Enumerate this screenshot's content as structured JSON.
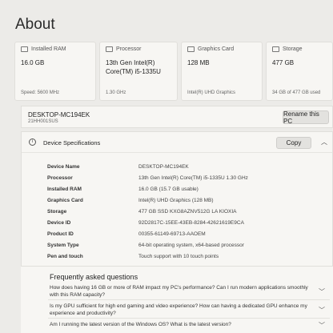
{
  "page": {
    "title": "About"
  },
  "cards": [
    {
      "icon": "ram-icon",
      "label": "Installed RAM",
      "value": "16.0 GB",
      "sub": "Speed: 5600 MHz"
    },
    {
      "icon": "processor-icon",
      "label": "Processor",
      "value": "13th Gen Intel(R) Core(TM) i5-1335U",
      "sub": "1.30 GHz"
    },
    {
      "icon": "graphics-card-icon",
      "label": "Graphics Card",
      "value": "128 MB",
      "sub": "Intel(R) UHD Graphics"
    },
    {
      "icon": "storage-icon",
      "label": "Storage",
      "value": "477 GB",
      "sub": "34 GB of 477 GB used"
    }
  ],
  "device": {
    "name": "DESKTOP-MC194EK",
    "model": "21HH001SUS",
    "rename_label": "Rename this PC"
  },
  "specs": {
    "title": "Device Specifications",
    "copy_label": "Copy",
    "rows": [
      {
        "key": "Device Name",
        "value": "DESKTOP-MC194EK"
      },
      {
        "key": "Processor",
        "value": "13th Gen Intel(R) Core(TM) i5-1335U   1.30 GHz"
      },
      {
        "key": "Installed RAM",
        "value": "16.0 GB (15.7 GB usable)"
      },
      {
        "key": "Graphics Card",
        "value": "Intel(R) UHD Graphics (128 MB)"
      },
      {
        "key": "Storage",
        "value": "477 GB SSD KXG8AZNV512G LA KIOXIA"
      },
      {
        "key": "Device ID",
        "value": "92D2817C-15EE-43EB-8284-42621619E9CA"
      },
      {
        "key": "Product ID",
        "value": "00355-61149-69713-AAOEM"
      },
      {
        "key": "System Type",
        "value": "64-bit operating system, x64-based processor"
      },
      {
        "key": "Pen and touch",
        "value": "Touch support with 10 touch points"
      }
    ]
  },
  "faq": {
    "title": "Frequently asked questions",
    "items": [
      "How does having 16 GB or more of RAM impact my PC's performance? Can I run modern applications smoothly with this RAM capacity?",
      "Is my GPU sufficient for high end gaming and video experience? How can having a dedicated GPU enhance my experience and productivity?",
      "Am I running the latest version of the Windows OS? What is the latest version?"
    ]
  }
}
